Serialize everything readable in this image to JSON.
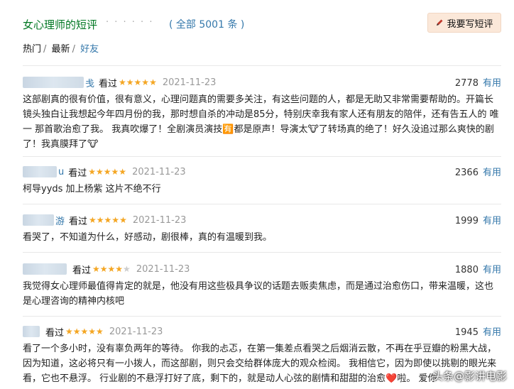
{
  "header": {
    "title": "女心理师的短评",
    "dots": "· · · · · ·",
    "count": "( 全部 5001 条 )",
    "write_button": "我要写短评"
  },
  "tabs": [
    {
      "label": "热门",
      "active": true
    },
    {
      "label": "最新",
      "active": false
    },
    {
      "label": "好友",
      "active": false
    }
  ],
  "reviews": [
    {
      "name_tail": "戋",
      "watched": "看过",
      "stars": 5,
      "date": "2021-11-23",
      "votes": "2778",
      "useful": "有用",
      "text": "这部剧真的很有价值，很有意义，心理问题真的需要多关注，有这些问题的人，都是无助又非常需要帮助的。开篇长镜头独白让我想起今年四月份的我，那时想自杀的冲动是85分，特别庆幸我有家人还有朋友的陪伴，还有告五人的 唯一 那首歌治愈了我。 我真吹爆了！全剧演员演技🈶都是原声！导演太🐮了转场真的绝了！好久没追过那么爽快的剧了！我真膜拜了🐮"
    },
    {
      "name_tail": "u",
      "watched": "看过",
      "stars": 5,
      "date": "2021-11-23",
      "votes": "2366",
      "useful": "有用",
      "text": "柯导yyds 加上杨紫 这片不绝不行"
    },
    {
      "name_tail": "游",
      "watched": "看过",
      "stars": 5,
      "date": "2021-11-23",
      "votes": "1999",
      "useful": "有用",
      "text": "看哭了，不知道为什么，好感动，剧很棒，真的有温暖到我。"
    },
    {
      "name_tail": "",
      "watched": "看过",
      "stars": 4,
      "date": "2021-11-23",
      "votes": "1880",
      "useful": "有用",
      "text": "我觉得女心理师最值得肯定的就是，他没有用这些极具争议的话题去贩卖焦虑，而是通过治愈伤口，带来温暖，这也是心理咨询的精神内核吧"
    },
    {
      "name_tail": "",
      "watched": "看过",
      "stars": 5,
      "date": "2021-11-23",
      "votes": "1945",
      "useful": "有用",
      "text": "看了一个多小时，没有辜负两年的等待。 你我的忐忑，在第一集差点看哭之后烟消云散，不再在乎豆瓣的粉黑大战，因为知道，这必将只有一小拨人，而这部剧，则只会交给群体庞大的观众检阅。 我相信它，因为即使以挑剔的眼光来看，它也不悬浮。 行业剧的不悬浮打好了底，剩下的，就是动人心弦的剧情和甜甜的治愈❤️啦。 爱你"
    }
  ],
  "watermark": "头条@影讲电影",
  "colors": {
    "link": "#3377aa",
    "title": "#007722",
    "star": "#f4a623",
    "button_bg": "#fbe8d9"
  }
}
